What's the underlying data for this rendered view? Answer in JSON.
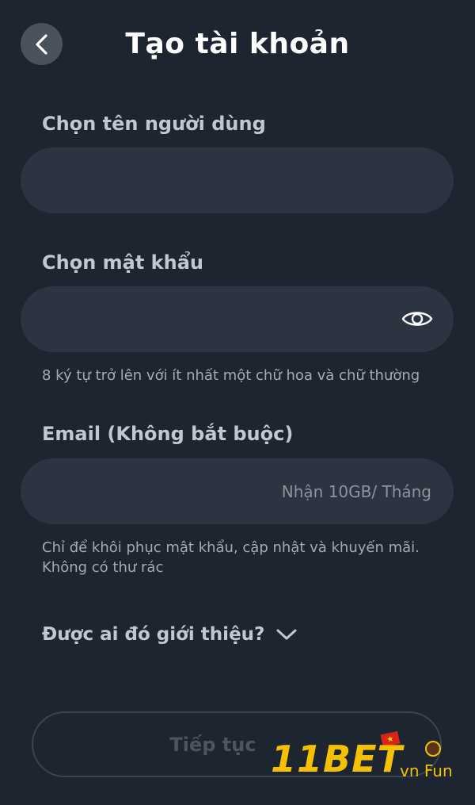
{
  "header": {
    "title": "Tạo tài khoản"
  },
  "username": {
    "label": "Chọn tên người dùng",
    "value": ""
  },
  "password": {
    "label": "Chọn mật khẩu",
    "value": "",
    "hint": "8 ký tự trở lên với ít nhất một chữ hoa và chữ thường"
  },
  "email": {
    "label": "Email  (Không bắt buộc)",
    "placeholder": "Nhận 10GB/ Tháng",
    "hint_line1": "Chỉ để khôi phục mật khẩu, cập nhật và khuyến mãi.",
    "hint_line2": "Không có thư rác"
  },
  "referral": {
    "label": "Được ai đó giới thiệu?"
  },
  "continue_button": {
    "label": "Tiếp tục"
  },
  "watermark": {
    "main": "11BET",
    "sub": "vn Fun"
  },
  "colors": {
    "background": "#1c2530",
    "field_background": "#2b3440",
    "watermark": "#f5c000"
  },
  "icons": {
    "back": "chevron-left-icon",
    "password_toggle": "eye-icon",
    "referral_expand": "chevron-down-icon"
  }
}
